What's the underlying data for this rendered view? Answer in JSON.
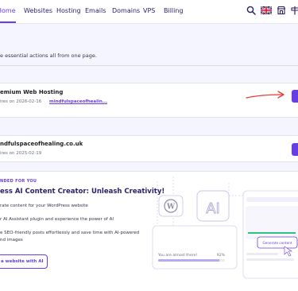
{
  "nav": {
    "items": [
      {
        "label": "Home",
        "active": true
      },
      {
        "label": "Websites"
      },
      {
        "label": "Hosting"
      },
      {
        "label": "Emails"
      },
      {
        "label": "Domains"
      },
      {
        "label": "VPS"
      },
      {
        "label": "Billing"
      }
    ],
    "icons": [
      "search-icon",
      "uk-flag-icon",
      "store-icon",
      "signpost-icon"
    ]
  },
  "subtitle": "e essential actions all from one page.",
  "hosting_card": {
    "title": "emium Web Hosting",
    "expires": "ires on 2026-02-16",
    "domain_link": "mindfulspaceofhealin..."
  },
  "domain_card": {
    "title": "ndfulspaceofhealing.co.uk",
    "expires": "ires on 2025-02-19"
  },
  "promo": {
    "recommended": "NDED FOR YOU",
    "title": "ess AI Content Creator: Unleash Creativity!",
    "lines": [
      "rate content for your WordPress website",
      "r AI Assistant plugin and experience the power of AI",
      "e SEO-friendly posts effortlessly and save time with AI-powered",
      "nd images"
    ],
    "button_label": "a website with AI",
    "illustration": {
      "ai_label": "AI",
      "progress_text": "You are almost there!",
      "progress_percent": "92%",
      "progress_value": 0.92,
      "generate_button": "Generate content"
    }
  },
  "colors": {
    "accent": "#673de6",
    "annotation_arrow": "#e53935",
    "background": "#f4f5ff"
  }
}
